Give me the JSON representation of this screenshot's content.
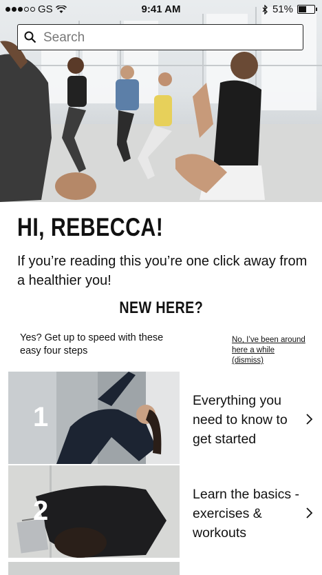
{
  "status_bar": {
    "carrier": "GS",
    "time": "9:41 AM",
    "battery": "51%",
    "battery_level": 0.51
  },
  "search": {
    "placeholder": "Search"
  },
  "greeting": "HI, REBECCA!",
  "intro_text": "If you’re reading this you’re one click away from a healthier you!",
  "new_here_title": "NEW HERE?",
  "steps_lead": "Yes? Get up to speed with these easy four steps",
  "dismiss_link": "No, I’ve been around here a while (dismiss)",
  "cards": [
    {
      "number": "1",
      "text": "Everything you need to know to get started",
      "image": "woman-stretching-photo",
      "icon": "chevron-right-icon"
    },
    {
      "number": "2",
      "text": "Learn the basics - exercises & workouts",
      "image": "woman-with-laptop-photo",
      "icon": "chevron-right-icon"
    }
  ],
  "hero": {
    "image": "group-fitness-class-photo"
  },
  "icons": [
    "signal-dots-icon",
    "wifi-icon",
    "bluetooth-icon",
    "battery-icon",
    "search-icon",
    "chevron-right-icon"
  ]
}
